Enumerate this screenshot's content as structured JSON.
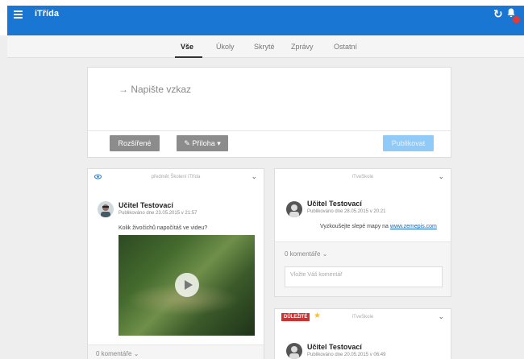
{
  "app": {
    "title": "iTřída"
  },
  "tabs": [
    {
      "label": "Vše",
      "active": true
    },
    {
      "label": "Úkoly"
    },
    {
      "label": "Skryté"
    },
    {
      "label": "Zprávy"
    },
    {
      "label": "Ostatní"
    }
  ],
  "composer": {
    "placeholder": "→  Napište vzkaz",
    "advanced_label": "Rozšířené",
    "attachment_label": "✎ Příloha ▾",
    "publish_label": "Publikovat"
  },
  "posts": [
    {
      "source": "předmět Školení iTřída",
      "author": "Učitel Testovací",
      "published": "Publikováno dne 23.05.2015 v 21:57",
      "text": "Kolik živočichů napočítáš ve videu?",
      "comments": "0 komentáře ⌄"
    },
    {
      "source": "iTveSkole",
      "author": "Učitel Testovací",
      "published": "Publikováno dne 28.05.2015 v 20:21",
      "text_prefix": "Vyzkoušejte slepé mapy na ",
      "link": "www.zemepis.com",
      "comments": "0 komentáře ⌄",
      "comment_placeholder": "Vložte Váš komentář"
    },
    {
      "badge": "DŮLEŽITÉ",
      "source": "iTveSkole",
      "author": "Učitel Testovací",
      "published": "Publikováno dne 20.05.2015 v 06:49"
    }
  ],
  "colors": {
    "appbar": "#1976d2",
    "important": "#d32f2f",
    "star": "#fbc02d"
  }
}
